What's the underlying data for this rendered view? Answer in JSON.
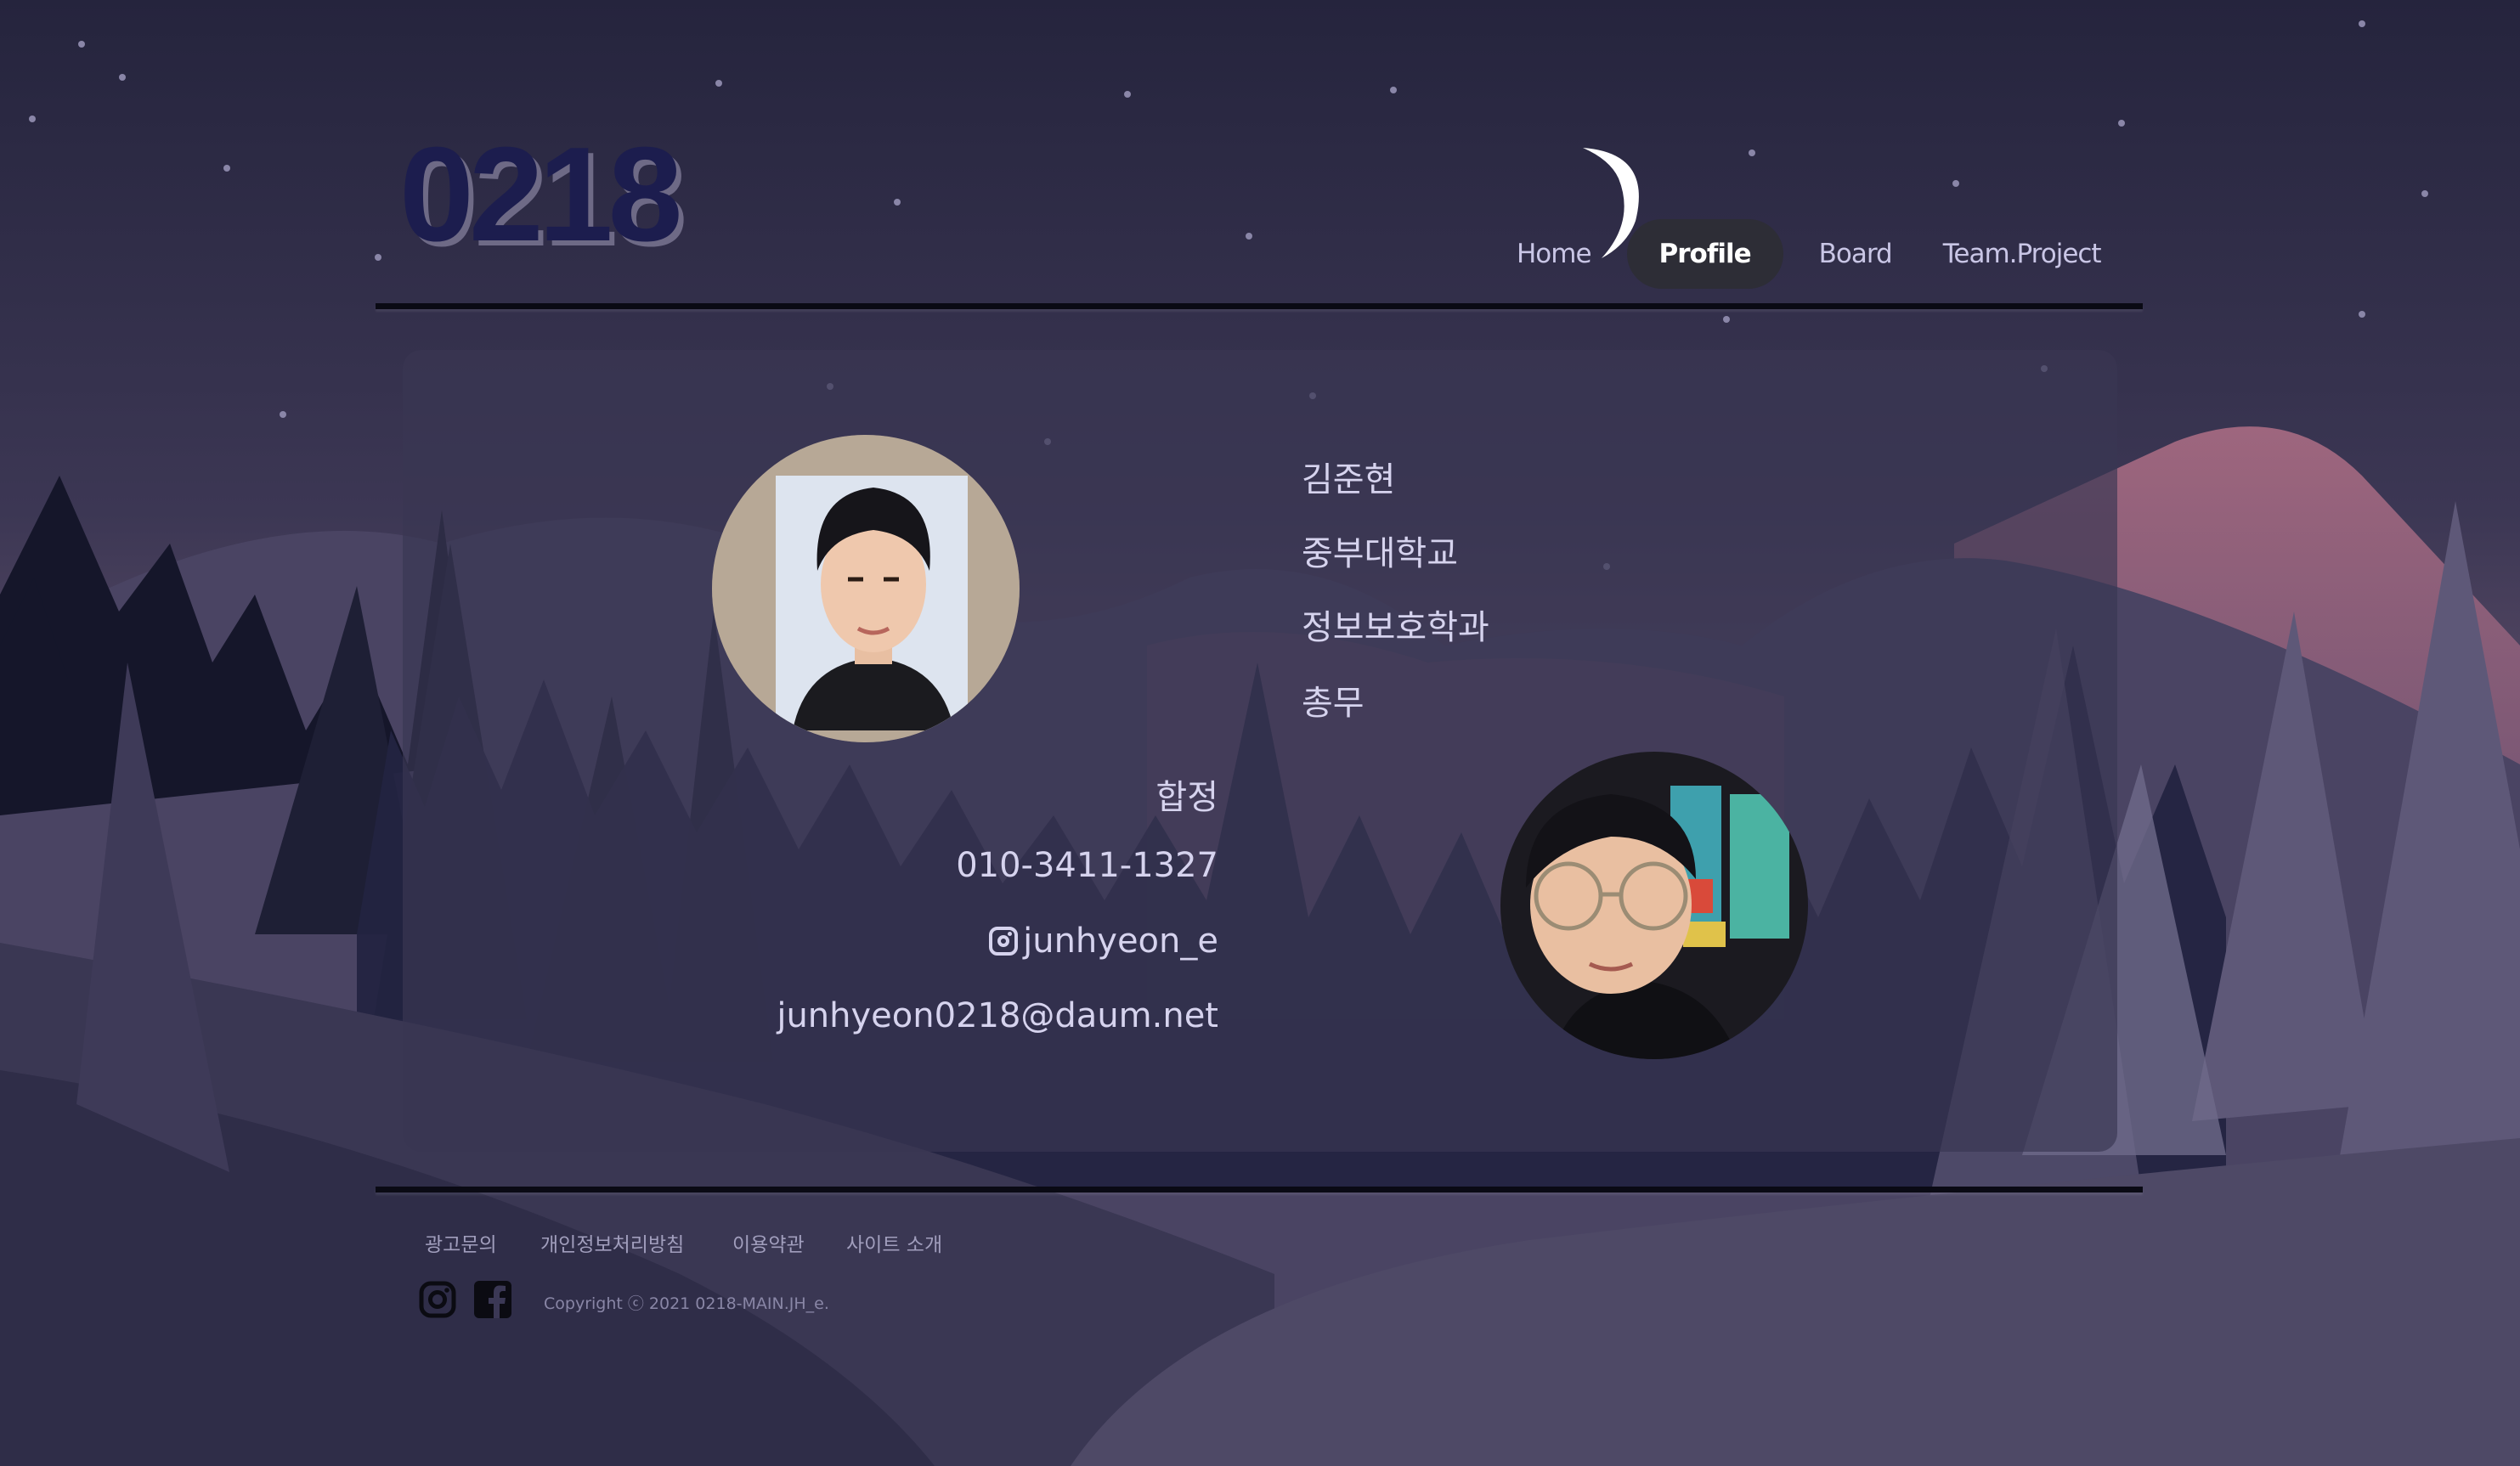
{
  "brand": {
    "logo_text": "0218"
  },
  "nav": {
    "items": [
      {
        "label": "Home",
        "active": false
      },
      {
        "label": "Profile",
        "active": true
      },
      {
        "label": "Board",
        "active": false
      },
      {
        "label": "Team.Project",
        "active": false
      }
    ]
  },
  "profile": {
    "name": "김준현",
    "school": "중부대학교",
    "department": "정보보호학과",
    "role": "총무",
    "hobby": "합정",
    "phone": "010-3411-1327",
    "instagram": "junhyeon_e",
    "email": "junhyeon0218@daum.net",
    "photos": [
      {
        "icon": "id-photo-portrait"
      },
      {
        "icon": "selfie-portrait"
      }
    ]
  },
  "footer": {
    "links": [
      "광고문의",
      "개인정보처리방침",
      "이용약관",
      "사이트 소개"
    ],
    "social_icons": [
      "instagram-icon",
      "facebook-icon"
    ],
    "copyright": "Copyright ⓒ 2021 0218-MAIN.JH_e."
  },
  "colors": {
    "sky_top": "#26253f",
    "sky_bottom": "#5b4e6a",
    "logo": "#1c1d4e",
    "nav_active_bg": "#2d2d36",
    "pink_mountain": "#b07088",
    "text": "#d6d3ee"
  }
}
